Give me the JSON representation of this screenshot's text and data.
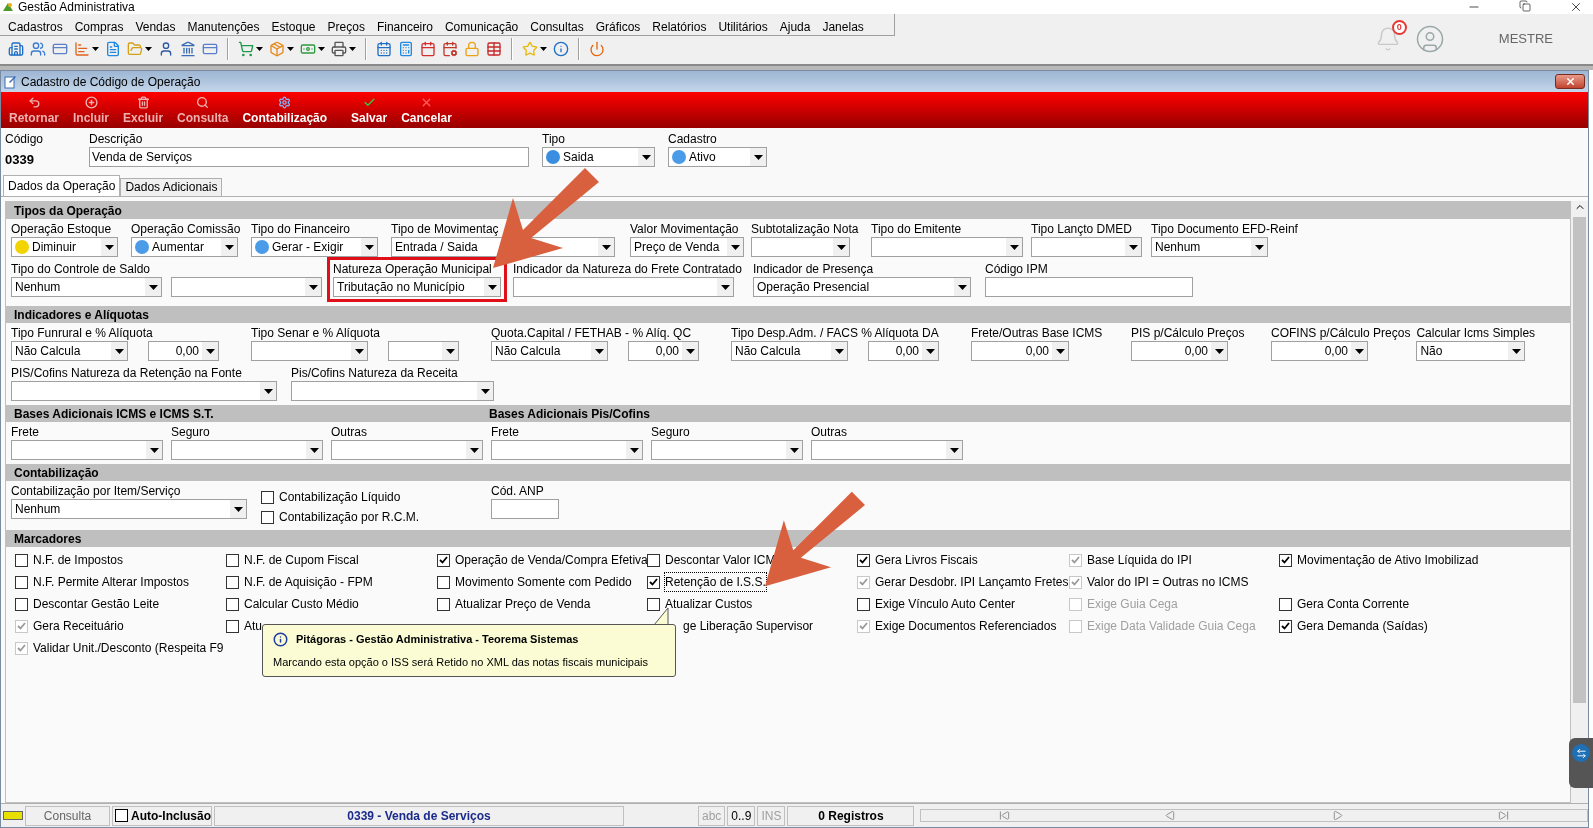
{
  "app": {
    "title": "Gestão Administrativa",
    "notifications": "0",
    "user": "MESTRE"
  },
  "menu": [
    "Cadastros",
    "Compras",
    "Vendas",
    "Manutenções",
    "Estoque",
    "Preços",
    "Financeiro",
    "Comunicação",
    "Consultas",
    "Gráficos",
    "Relatórios",
    "Utilitários",
    "Ajuda",
    "Janelas"
  ],
  "window": {
    "title": "Cadastro de Código de Operação"
  },
  "actions": [
    {
      "kind": "return",
      "label": "Retornar",
      "disabled": true
    },
    {
      "kind": "add",
      "label": "Incluir",
      "disabled": true
    },
    {
      "kind": "delete",
      "label": "Excluir",
      "disabled": true
    },
    {
      "kind": "search",
      "label": "Consulta",
      "disabled": true
    },
    {
      "kind": "settings",
      "label": "Contabilização",
      "disabled": false
    },
    {
      "kind": "save",
      "label": "Salvar",
      "disabled": false
    },
    {
      "kind": "cancel",
      "label": "Cancelar",
      "disabled": false
    }
  ],
  "header": {
    "code_label": "Código",
    "code": "0339",
    "description_label": "Descrição",
    "description": "Venda de Serviços",
    "type": {
      "label": "Tipo",
      "value": "Saida",
      "color": "#3a8ee0"
    },
    "register": {
      "label": "Cadastro",
      "value": "Ativo",
      "color": "#4a9be8"
    }
  },
  "tabs": [
    {
      "label": "Dados da Operação",
      "selected": true
    },
    {
      "label": "Dados Adicionais",
      "selected": false
    }
  ],
  "sections": [
    {
      "titles": [
        "Tipos da Operação"
      ],
      "rows": [
        {
          "fields": [
            {
              "kind": "combo",
              "label": "Operação Estoque",
              "value": "Diminuir",
              "color": "#f2d400"
            },
            {
              "kind": "combo",
              "label": "Operação Comissão",
              "value": "Aumentar",
              "color": "#4a9be8"
            },
            {
              "kind": "combo",
              "label": "Tipo do Financeiro",
              "value": "Gerar - Exigir",
              "color": "#4a9be8"
            },
            {
              "kind": "combo",
              "label": "Tipo de Movimentaç",
              "value": "Entrada / Saida"
            },
            {
              "kind": "combo",
              "label": "Valor Movimentação",
              "value": "Preço de Venda"
            },
            {
              "kind": "combo",
              "label": "Subtotalização Nota"
            },
            {
              "kind": "combo",
              "label": "Tipo do Emitente"
            },
            {
              "kind": "combo",
              "label": "Tipo Lançto DMED"
            },
            {
              "kind": "combo",
              "label": "Tipo Documento EFD-Reinf",
              "value": "Nenhum"
            }
          ]
        },
        {
          "fields": [
            {
              "kind": "combo",
              "label": "Tipo do Controle de Saldo",
              "value": "Nenhum"
            },
            {
              "kind": "combo"
            },
            {
              "kind": "combo",
              "label": "Natureza Operação Municipal",
              "value": "Tributação no Município",
              "highlighted": true
            },
            {
              "kind": "combo",
              "label": "Indicador da Natureza do Frete Contratado"
            },
            {
              "kind": "combo",
              "label": "Indicador de Presença",
              "value": "Operação Presencial"
            },
            {
              "kind": "input",
              "label": "Código IPM"
            }
          ]
        }
      ]
    },
    {
      "titles": [
        "Indicadores e Alíquotas"
      ],
      "rows": [
        {
          "fields": [
            {
              "kind": "pair",
              "label": "Tipo Funrural e % Alíquota",
              "value": "Não Calcula",
              "number": "0,00"
            },
            {
              "kind": "pair",
              "label": "Tipo Senar e % Alíquota"
            },
            {
              "kind": "pair",
              "label": "Quota.Capital / FETHAB - % Alíq. QC",
              "value": "Não Calcula",
              "number": "0,00"
            },
            {
              "kind": "pair",
              "label": "Tipo Desp.Adm. / FACS % Alíquota DA",
              "value": "Não Calcula",
              "number": "0,00"
            },
            {
              "kind": "number",
              "label": "Frete/Outras Base ICMS",
              "number": "0,00"
            },
            {
              "kind": "number",
              "label": "PIS p/Cálculo Preços",
              "number": "0,00"
            },
            {
              "kind": "number",
              "label": "COFINS p/Cálculo Preços",
              "number": "0,00"
            },
            {
              "kind": "combo",
              "label": "Calcular Icms Simples",
              "value": "Não"
            }
          ]
        },
        {
          "fields": [
            {
              "kind": "combo",
              "label": "PIS/Cofins Natureza da Retenção na Fonte"
            },
            {
              "kind": "combo",
              "label": "Pis/Cofins Natureza da Receita"
            }
          ]
        }
      ]
    },
    {
      "titles": [
        "Bases Adicionais ICMS e ICMS S.T.",
        "Bases Adicionais Pis/Cofins"
      ],
      "rows": [
        {
          "fields": [
            {
              "kind": "combo",
              "label": "Frete"
            },
            {
              "kind": "combo",
              "label": "Seguro"
            },
            {
              "kind": "combo",
              "label": "Outras"
            },
            {
              "kind": "combo",
              "label": "Frete"
            },
            {
              "kind": "combo",
              "label": "Seguro"
            },
            {
              "kind": "combo",
              "label": "Outras"
            }
          ]
        }
      ]
    },
    {
      "titles": [
        "Contabilização"
      ],
      "rows": [
        {
          "fields": [
            {
              "kind": "combo",
              "label": "Contabilização por Item/Serviço",
              "value": "Nenhum"
            },
            {
              "kind": "checks",
              "items": [
                {
                  "label": "Contabilização Líquido",
                  "checked": false
                },
                {
                  "label": "Contabilização por R.C.M.",
                  "checked": false
                }
              ]
            },
            {
              "kind": "input",
              "label": "Cód. ANP"
            }
          ]
        }
      ]
    }
  ],
  "markers": {
    "title": "Marcadores",
    "rows": [
      [
        {
          "kind": "checkbox",
          "label": "N.F. de Impostos",
          "checked": false
        },
        {
          "kind": "checkbox",
          "label": "N.F. de Cupom Fiscal",
          "checked": false
        },
        {
          "kind": "checkbox",
          "label": "Operação de Venda/Compra Efetiva",
          "checked": true
        },
        {
          "kind": "checkbox",
          "label": "Descontar Valor ICM",
          "checked": false
        },
        {
          "kind": "checkbox",
          "label": "Gera Livros Fiscais",
          "checked": true
        },
        {
          "kind": "checkbox",
          "label": "Base Líquida do IPI",
          "checked": true,
          "greyed": true
        },
        {
          "kind": "checkbox",
          "label": "Movimentação de Ativo Imobilizad",
          "checked": true
        }
      ],
      [
        {
          "kind": "checkbox",
          "label": "N.F. Permite Alterar Impostos",
          "checked": false
        },
        {
          "kind": "checkbox",
          "label": "N.F. de Aquisição - FPM",
          "checked": false
        },
        {
          "kind": "checkbox",
          "label": "Movimento Somente com Pedido",
          "checked": false
        },
        {
          "kind": "checkbox",
          "label": "Retenção de I.S.S.",
          "checked": true,
          "focused": true
        },
        {
          "kind": "checkbox",
          "label": "Gerar Desdobr. IPI Lançamto Fretes",
          "checked": true,
          "greyed": true
        },
        {
          "kind": "checkbox",
          "label": "Valor do IPI = Outras no ICMS",
          "checked": true,
          "greyed": true
        },
        {
          "kind": "blank"
        }
      ],
      [
        {
          "kind": "checkbox",
          "label": "Descontar Gestão Leite",
          "checked": false
        },
        {
          "kind": "checkbox",
          "label": "Calcular Custo Médio",
          "checked": false
        },
        {
          "kind": "checkbox",
          "label": "Atualizar Preço de Venda",
          "checked": false
        },
        {
          "kind": "checkbox",
          "label": "Atualizar Custos",
          "checked": false
        },
        {
          "kind": "checkbox",
          "label": "Exige Vínculo Auto Center",
          "checked": false
        },
        {
          "kind": "checkbox",
          "label": "Exige Guia Cega",
          "checked": false,
          "disabled": true
        },
        {
          "kind": "checkbox",
          "label": "Gera Conta Corrente",
          "checked": false
        }
      ],
      [
        {
          "kind": "checkbox",
          "label": "Gera Receituário",
          "checked": true,
          "greyed": true
        },
        {
          "kind": "checkbox",
          "label": "Atu",
          "checked": false
        },
        {
          "kind": "blank"
        },
        {
          "kind": "clipped",
          "label": "ge Liberação Supervisor"
        },
        {
          "kind": "checkbox",
          "label": "Exige Documentos Referenciados",
          "checked": true,
          "greyed": true
        },
        {
          "kind": "checkbox",
          "label": "Exige Data Validade Guia Cega",
          "checked": false,
          "disabled": true
        },
        {
          "kind": "checkbox",
          "label": "Gera Demanda (Saídas)",
          "checked": true
        }
      ],
      [
        {
          "kind": "checkbox",
          "label": "Validar Unit./Desconto (Respeita F9",
          "checked": true,
          "greyed": true
        }
      ]
    ]
  },
  "tooltip": {
    "title": "Pitágoras - Gestão Administrativa - Teorema Sistemas",
    "text": "Marcando esta opção o ISS será Retido no XML das notas fiscais municipais"
  },
  "status_bar": {
    "mode": "Consulta",
    "auto_insert": {
      "label": "Auto-Inclusão",
      "checked": false
    },
    "record": "0339 - Venda de Serviços",
    "indicators": [
      {
        "label": "abc",
        "active": false
      },
      {
        "label": "0..9",
        "active": true
      },
      {
        "label": "INS",
        "active": false
      }
    ],
    "count": "0 Registros"
  }
}
